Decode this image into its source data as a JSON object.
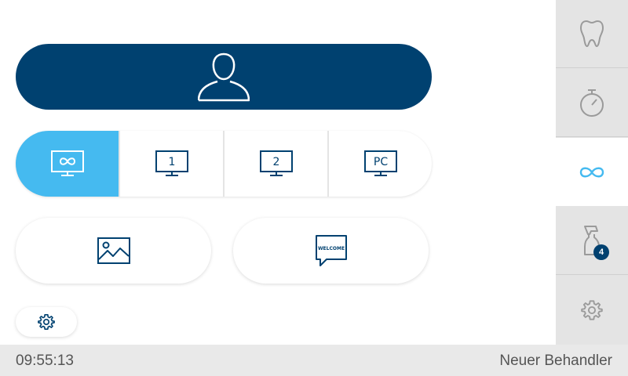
{
  "segments": [
    {
      "icon": "monitor-infinity-icon",
      "active": true
    },
    {
      "icon": "monitor-1-icon",
      "label": "1"
    },
    {
      "icon": "monitor-2-icon",
      "label": "2"
    },
    {
      "icon": "monitor-pc-icon",
      "label": "PC"
    }
  ],
  "welcome_icon_text": "WELCOME",
  "sidebar": [
    {
      "icon": "tooth-icon"
    },
    {
      "icon": "stopwatch-icon"
    },
    {
      "icon": "infinity-icon",
      "active": true
    },
    {
      "icon": "spray-bottle-icon",
      "badge": "4"
    },
    {
      "icon": "gear-icon"
    }
  ],
  "status": {
    "time": "09:55:13",
    "user": "Neuer Behandler"
  },
  "colors": {
    "primary": "#004170",
    "accent": "#45baf0"
  }
}
